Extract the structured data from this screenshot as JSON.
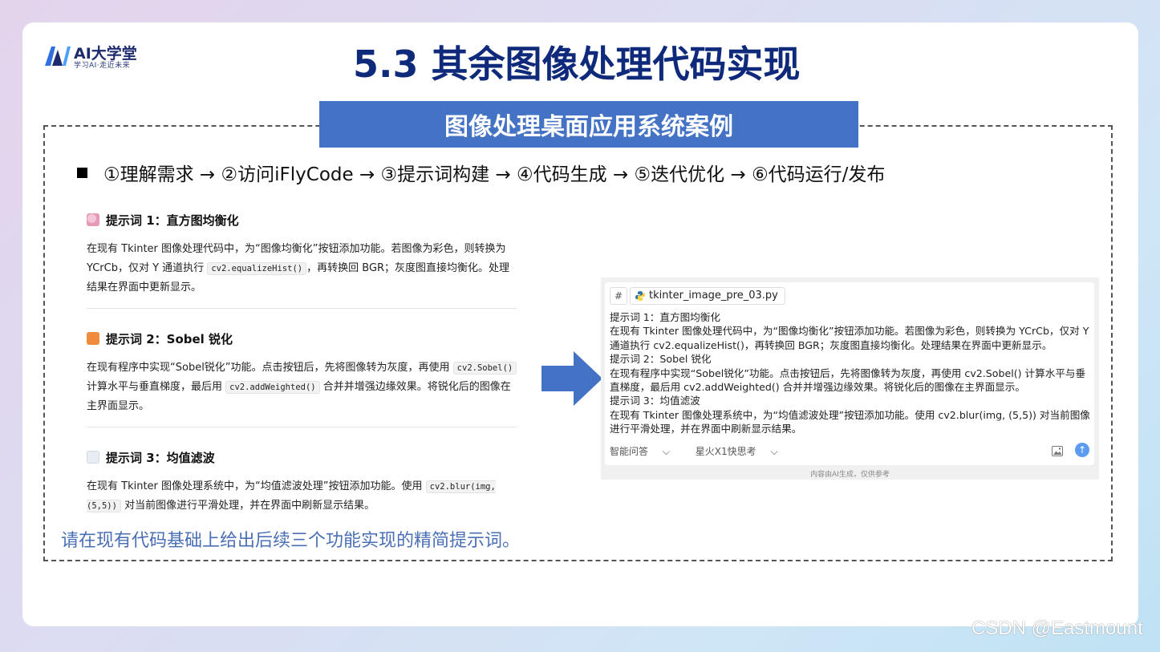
{
  "logo": {
    "name": "AI大学堂",
    "tagline": "学习AI·走近未来"
  },
  "slide": {
    "title": "5.3 其余图像处理代码实现",
    "banner": "图像处理桌面应用系统案例",
    "steps": "①理解需求 → ②访问iFlyCode → ③提示词构建 → ④代码生成 → ⑤迭代优化 → ⑥代码运行/发布",
    "bottom_note": "请在现有代码基础上给出后续三个功能实现的精简提示词。"
  },
  "prompts": [
    {
      "heading": "提示词 1：直方图均衡化",
      "icon": "palette-icon",
      "t1": "在现有 Tkinter 图像处理代码中，为“图像均衡化”按钮添加功能。若图像为彩色，则转换为 YCrCb，仅对 Y 通道执行 ",
      "c1": "cv2.equalizeHist()",
      "t2": "，再转换回 BGR；灰度图直接均衡化。处理结果在界面中更新显示。"
    },
    {
      "heading": "提示词 2：Sobel 锐化",
      "icon": "sparkle-icon",
      "t1": "在现有程序中实现“Sobel锐化”功能。点击按钮后，先将图像转为灰度，再使用 ",
      "c1": "cv2.Sobel()",
      "t2": " 计算水平与垂直梯度，最后用 ",
      "c2": "cv2.addWeighted()",
      "t3": " 合并并增强边缘效果。将锐化后的图像在主界面显示。"
    },
    {
      "heading": "提示词 3：均值滤波",
      "icon": "cloud-icon",
      "t1": "在现有 Tkinter 图像处理系统中，为“均值滤波处理”按钮添加功能。使用 ",
      "c1": "cv2.blur(img, (5,5))",
      "t2": " 对当前图像进行平滑处理，并在界面中刷新显示结果。"
    }
  ],
  "chat": {
    "hash": "#",
    "file_name": "tkinter_image_pre_03.py",
    "lines": [
      "提示词 1：直方图均衡化",
      "在现有 Tkinter 图像处理代码中，为“图像均衡化”按钮添加功能。若图像为彩色，则转换为 YCrCb，仅对 Y 通道执行 cv2.equalizeHist()，再转换回 BGR；灰度图直接均衡化。处理结果在界面中更新显示。",
      " 提示词 2：Sobel 锐化",
      "在现有程序中实现“Sobel锐化”功能。点击按钮后，先将图像转为灰度，再使用 cv2.Sobel() 计算水平与垂直梯度，最后用 cv2.addWeighted() 合并并增强边缘效果。将锐化后的图像在主界面显示。",
      "提示词 3：均值滤波",
      "在现有 Tkinter 图像处理系统中，为“均值滤波处理”按钮添加功能。使用 cv2.blur(img, (5,5)) 对当前图像进行平滑处理，并在界面中刷新显示结果。"
    ],
    "mode": "智能问答",
    "model": "星火X1快思考",
    "disclaimer": "内容由AI生成，仅供参考"
  },
  "watermark": "CSDN @Eastmount",
  "colors": {
    "title": "#0f2a7a",
    "banner": "#4472c4",
    "note": "#4a6fb5",
    "send": "#5b9cf0"
  }
}
